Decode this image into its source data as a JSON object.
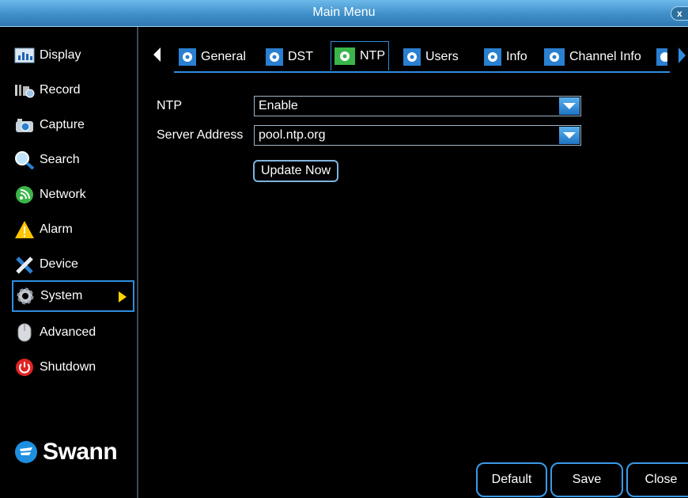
{
  "window": {
    "title": "Main Menu",
    "close_glyph": "x"
  },
  "sidebar": {
    "items": [
      {
        "label": "Display",
        "icon": "display-icon",
        "active": false
      },
      {
        "label": "Record",
        "icon": "record-icon",
        "active": false
      },
      {
        "label": "Capture",
        "icon": "camera-icon",
        "active": false
      },
      {
        "label": "Search",
        "icon": "search-icon",
        "active": false
      },
      {
        "label": "Network",
        "icon": "network-icon",
        "active": false
      },
      {
        "label": "Alarm",
        "icon": "alarm-icon",
        "active": false
      },
      {
        "label": "Device",
        "icon": "device-tools-icon",
        "active": false
      },
      {
        "label": "System",
        "icon": "gear-icon",
        "active": true
      },
      {
        "label": "Advanced",
        "icon": "mouse-icon",
        "active": false
      },
      {
        "label": "Shutdown",
        "icon": "power-icon",
        "active": false
      }
    ],
    "logo_text": "Swann"
  },
  "tabs": [
    {
      "label": "General",
      "active": false
    },
    {
      "label": "DST",
      "active": false
    },
    {
      "label": "NTP",
      "active": true
    },
    {
      "label": "Users",
      "active": false
    },
    {
      "label": "Info",
      "active": false
    },
    {
      "label": "Channel Info",
      "active": false
    }
  ],
  "form": {
    "ntp": {
      "label": "NTP",
      "value": "Enable"
    },
    "server": {
      "label": "Server Address",
      "value": "pool.ntp.org"
    },
    "update_button": "Update Now"
  },
  "footer": {
    "default_label": "Default",
    "save_label": "Save",
    "close_label": "Close"
  },
  "colors": {
    "accent": "#2e8de0",
    "title_bar": "#3f8fc9",
    "active_arrow": "#ffd400"
  }
}
